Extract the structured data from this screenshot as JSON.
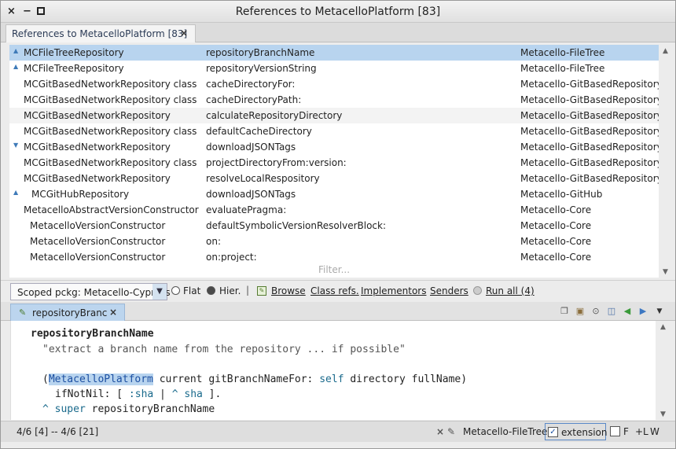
{
  "window": {
    "title": "References to MetacelloPlatform [83]",
    "close_glyph": "×",
    "min_glyph": "−"
  },
  "tab": {
    "label": "References to MetacelloPlatform [83]",
    "close_glyph": "×"
  },
  "results": {
    "rows": [
      {
        "cls": "MCFileTreeRepository",
        "selector": "repositoryBranchName",
        "package": "Metacello-FileTree",
        "arrow": "▲"
      },
      {
        "cls": "MCFileTreeRepository",
        "selector": "repositoryVersionString",
        "package": "Metacello-FileTree",
        "arrow": "▲"
      },
      {
        "cls": "MCGitBasedNetworkRepository class",
        "selector": "cacheDirectoryFor:",
        "package": "Metacello-GitBasedRepository",
        "arrow": ""
      },
      {
        "cls": "MCGitBasedNetworkRepository class",
        "selector": "cacheDirectoryPath:",
        "package": "Metacello-GitBasedRepository",
        "arrow": ""
      },
      {
        "cls": "MCGitBasedNetworkRepository",
        "selector": "calculateRepositoryDirectory",
        "package": "Metacello-GitBasedRepository",
        "arrow": ""
      },
      {
        "cls": "MCGitBasedNetworkRepository class",
        "selector": "defaultCacheDirectory",
        "package": "Metacello-GitBasedRepository",
        "arrow": ""
      },
      {
        "cls": "MCGitBasedNetworkRepository",
        "selector": "downloadJSONTags",
        "package": "Metacello-GitBasedRepository",
        "arrow": "▼"
      },
      {
        "cls": "MCGitBasedNetworkRepository class",
        "selector": "projectDirectoryFrom:version:",
        "package": "Metacello-GitBasedRepository",
        "arrow": ""
      },
      {
        "cls": "MCGitBasedNetworkRepository",
        "selector": "resolveLocalRespository",
        "package": "Metacello-GitBasedRepository",
        "arrow": ""
      },
      {
        "cls": "MCGitHubRepository",
        "selector": "downloadJSONTags",
        "package": "Metacello-GitHub",
        "arrow": "▲"
      },
      {
        "cls": "MetacelloAbstractVersionConstructor",
        "selector": "evaluatePragma:",
        "package": "Metacello-Core",
        "arrow": ""
      },
      {
        "cls": "MetacelloVersionConstructor",
        "selector": "defaultSymbolicVersionResolverBlock:",
        "package": "Metacello-Core",
        "arrow": ""
      },
      {
        "cls": "MetacelloVersionConstructor",
        "selector": "on:",
        "package": "Metacello-Core",
        "arrow": ""
      },
      {
        "cls": "MetacelloVersionConstructor",
        "selector": "on:project:",
        "package": "Metacello-Core",
        "arrow": ""
      }
    ],
    "filter_placeholder": "Filter..."
  },
  "toolbar": {
    "scope_value": "Scoped pckg: Metacello-Cypress",
    "flat_label": "Flat",
    "hier_label": "Hier.",
    "separator": "|",
    "browse_label": "Browse",
    "class_refs_label": "Class refs.",
    "implementors_label": "Implementors",
    "senders_label": "Senders",
    "run_all_label": "Run all (4)"
  },
  "editor_tab": {
    "label": "repositoryBranchName",
    "close_glyph": "×"
  },
  "code": {
    "line1": "repositoryBranchName",
    "line2": "\"extract a branch name from the repository ... if possible\"",
    "line3_paren": "(",
    "line3_class": "MetacelloPlatform",
    "line3_rest1": " current gitBranchNameFor: ",
    "line3_self": "self",
    "line3_rest2": " directory fullName)",
    "line4_pre": "ifNotNil: [ ",
    "line4_sha": ":sha",
    "line4_mid": " | ",
    "line4_caret": "^",
    "line4_sha2": " sha",
    "line4_end": " ].",
    "line5_caret": "^",
    "line5_super": " super",
    "line5_rest": " repositoryBranchName"
  },
  "status": {
    "position": "4/6 [4] -- 4/6 [21]",
    "package": "Metacello-FileTree",
    "extension_label": "extension",
    "extension_checked": true,
    "f_label": "F",
    "l_label": "+L",
    "w_label": "W"
  }
}
